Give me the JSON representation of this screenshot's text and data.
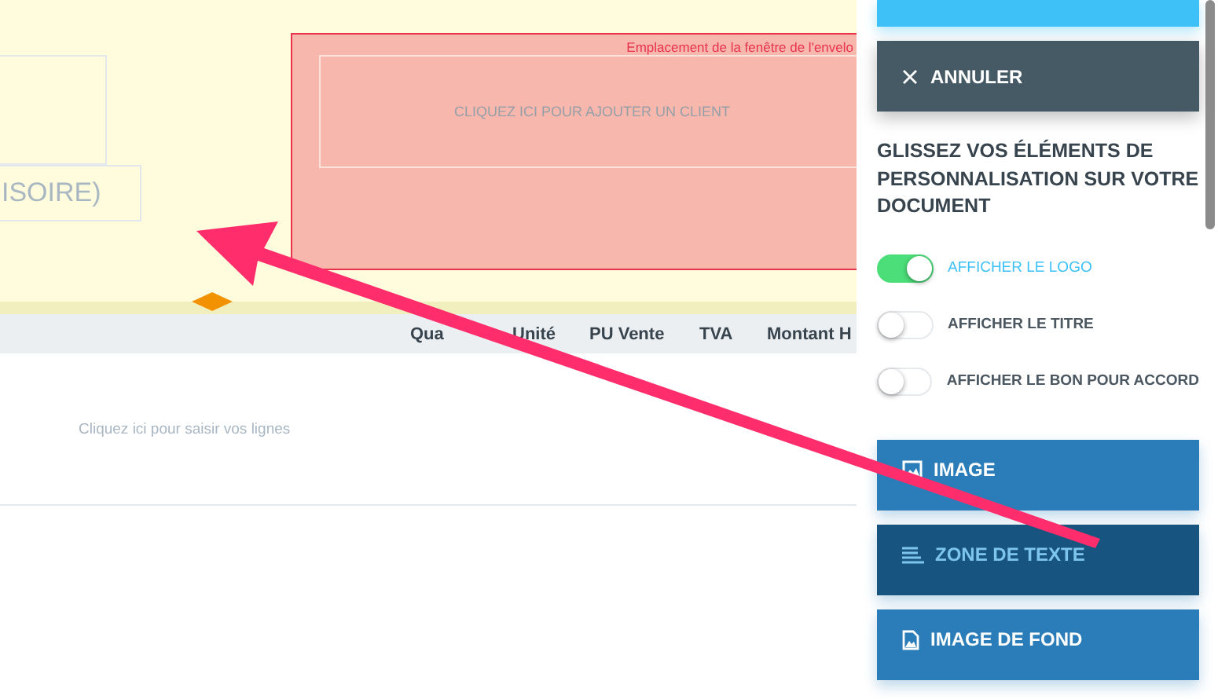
{
  "document": {
    "title_fragment": "ISOIRE)",
    "envelope": {
      "label": "Emplacement de la fenêtre de l'envelo",
      "client_prompt": "CLIQUEZ ICI POUR AJOUTER UN CLIENT"
    },
    "columns": [
      "Qua",
      "Unité",
      "PU Vente",
      "TVA",
      "Montant H"
    ],
    "lines_prompt": "Cliquez ici pour saisir vos lignes"
  },
  "sidebar": {
    "cancel": "ANNULER",
    "heading": "GLISSEZ VOS ÉLÉMENTS DE PERSONNALISATION SUR VOTRE DOCUMENT",
    "toggles": [
      {
        "label": "AFFICHER LE LOGO",
        "on": true
      },
      {
        "label": "AFFICHER LE TITRE",
        "on": false
      },
      {
        "label": "AFFICHER LE BON POUR ACCORD",
        "on": false
      }
    ],
    "elements": [
      {
        "kind": "image",
        "label": "IMAGE",
        "selected": false
      },
      {
        "kind": "text",
        "label": "ZONE DE TEXTE",
        "selected": true
      },
      {
        "kind": "background",
        "label": "IMAGE DE FOND",
        "selected": false
      }
    ]
  }
}
